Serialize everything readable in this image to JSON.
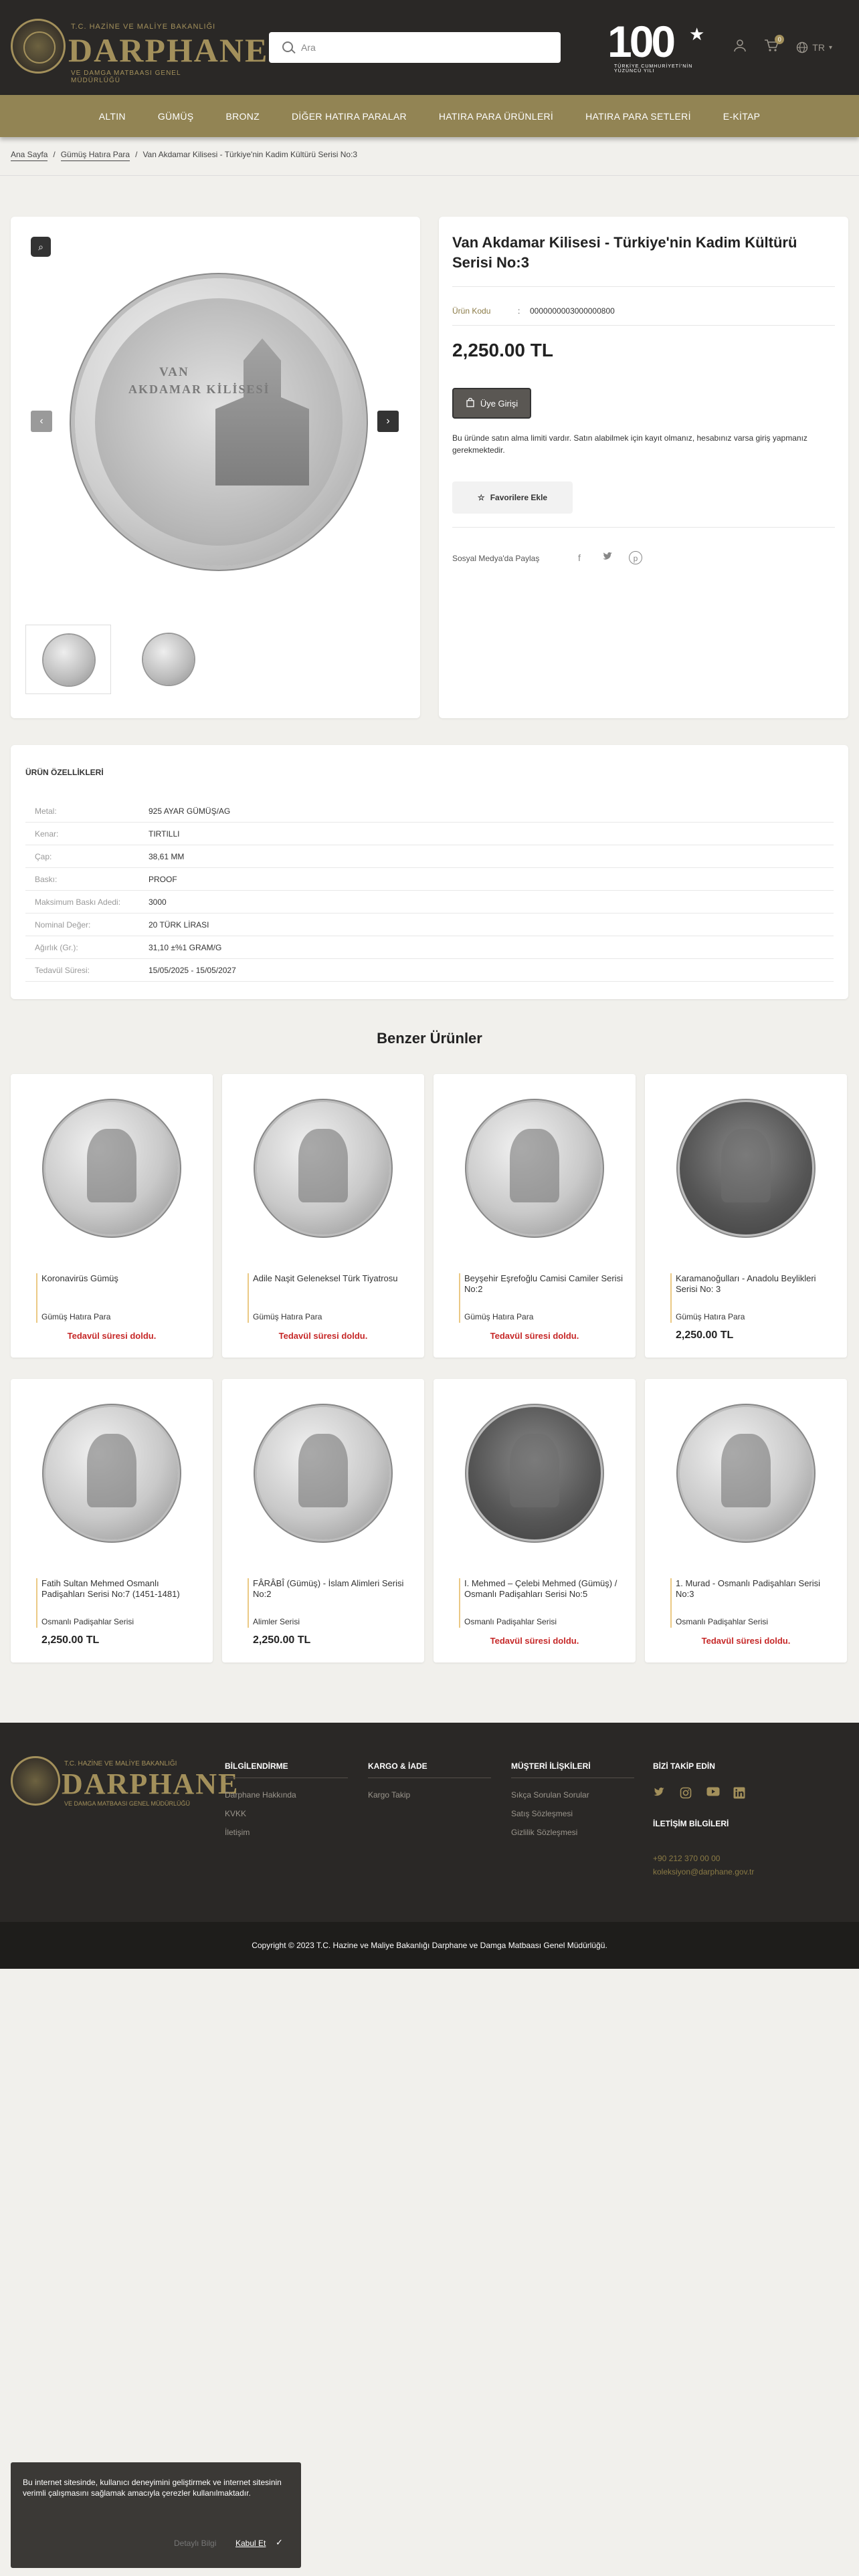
{
  "header": {
    "logo_sup": "T.C. HAZİNE VE MALİYE BAKANLIĞI",
    "logo_name": "DARPHANE",
    "logo_sub": "VE DAMGA MATBAASI GENEL MÜDÜRLÜĞÜ",
    "search_placeholder": "Ara",
    "centennial_num": "100",
    "centennial_caption": "TÜRKİYE CUMHURİYETİ'NİN YÜZÜNCÜ YILI",
    "cart_count": "0",
    "language": "TR"
  },
  "nav": [
    "ALTIN",
    "GÜMÜŞ",
    "BRONZ",
    "DİĞER HATIRA PARALAR",
    "HATIRA PARA ÜRÜNLERİ",
    "HATIRA PARA SETLERİ",
    "E-KİTAP"
  ],
  "breadcrumb": {
    "home": "Ana Sayfa",
    "category": "Gümüş Hatıra Para",
    "current": "Van Akdamar Kilisesi - Türkiye'nin Kadim Kültürü Serisi No:3",
    "sep": "/"
  },
  "gallery": {
    "coin_text_1": "VAN",
    "coin_text_2": "AKDAMAR KİLİSESİ"
  },
  "product": {
    "title": "Van Akdamar Kilisesi - Türkiye'nin Kadim Kültürü Serisi No:3",
    "code_label": "Ürün Kodu",
    "code_colon": ":",
    "code_value": "0000000003000000800",
    "price": "2,250.00 TL",
    "member_button": "Üye Girişi",
    "note": "Bu üründe satın alma limiti vardır. Satın alabilmek için kayıt olmanız, hesabınız varsa giriş yapmanız gerekmektedir.",
    "favorite_button": "Favorilere Ekle",
    "share_label": "Sosyal Medya'da Paylaş"
  },
  "features": {
    "title": "ÜRÜN ÖZELLİKLERİ",
    "rows": [
      {
        "k": "Metal:",
        "v": "925 AYAR GÜMÜŞ/AG"
      },
      {
        "k": "Kenar:",
        "v": "TIRTILLI"
      },
      {
        "k": "Çap:",
        "v": "38,61 MM"
      },
      {
        "k": "Baskı:",
        "v": "PROOF"
      },
      {
        "k": "Maksimum Baskı Adedi:",
        "v": "3000"
      },
      {
        "k": "Nominal Değer:",
        "v": "20 TÜRK LİRASI"
      },
      {
        "k": "Ağırlık (Gr.):",
        "v": "31,10 ±%1 GRAM/G"
      },
      {
        "k": "Tedavül Süresi:",
        "v": "15/05/2025 - 15/05/2027"
      }
    ]
  },
  "similar": {
    "title": "Benzer Ürünler",
    "items": [
      {
        "name": "Koronavirüs Gümüş",
        "category": "Gümüş Hatıra Para",
        "status": "Tedavül süresi doldu.",
        "price": ""
      },
      {
        "name": "Adile Naşit Geleneksel Türk Tiyatrosu",
        "category": "Gümüş Hatıra Para",
        "status": "Tedavül süresi doldu.",
        "price": ""
      },
      {
        "name": "Beyşehir Eşrefoğlu Camisi Camiler Serisi No:2",
        "category": "Gümüş Hatıra Para",
        "status": "Tedavül süresi doldu.",
        "price": ""
      },
      {
        "name": "Karamanoğulları - Anadolu Beylikleri Serisi No: 3",
        "category": "Gümüş Hatıra Para",
        "status": "",
        "price": "2,250.00 TL"
      },
      {
        "name": "Fatih Sultan Mehmed Osmanlı Padişahları Serisi No:7 (1451-1481)",
        "category": "Osmanlı Padişahlar Serisi",
        "status": "",
        "price": "2,250.00 TL"
      },
      {
        "name": "FÂRÂBÎ (Gümüş) - İslam Alimleri Serisi No:2",
        "category": "Alimler Serisi",
        "status": "",
        "price": "2,250.00 TL"
      },
      {
        "name": "I. Mehmed – Çelebi Mehmed (Gümüş) / Osmanlı Padişahları Serisi No:5",
        "category": "Osmanlı Padişahlar Serisi",
        "status": "Tedavül süresi doldu.",
        "price": ""
      },
      {
        "name": "1. Murad - Osmanlı Padişahları Serisi No:3",
        "category": "Osmanlı Padişahlar Serisi",
        "status": "Tedavül süresi doldu.",
        "price": ""
      }
    ]
  },
  "footer": {
    "logo_sup": "T.C. HAZİNE VE MALİYE BAKANLIĞI",
    "logo_name": "DARPHANE",
    "logo_sub": "VE DAMGA MATBAASI GENEL MÜDÜRLÜĞÜ",
    "col1": {
      "title": "BİLGİLENDİRME",
      "links": [
        "Darphane Hakkında",
        "KVKK",
        "İletişim"
      ]
    },
    "col2": {
      "title": "KARGO & İADE",
      "links": [
        "Kargo Takip"
      ]
    },
    "col3": {
      "title": "MÜŞTERİ İLİŞKİLERİ",
      "links": [
        "Sıkça Sorulan Sorular",
        "Satış Sözleşmesi",
        "Gizlilik Sözleşmesi"
      ]
    },
    "follow_title": "BİZİ TAKİP EDİN",
    "contact_title": "İLETİŞİM BİLGİLERİ",
    "phone": "+90 212 370 00 00",
    "email": "koleksiyon@darphane.gov.tr",
    "copyright": "Copyright © 2023 T.C. Hazine ve Maliye Bakanlığı Darphane ve Damga Matbaası Genel Müdürlüğü."
  },
  "cookie": {
    "text": "Bu internet sitesinde, kullanıcı deneyimini geliştirmek ve internet sitesinin verimli çalışmasını sağlamak amacıyla çerezler kullanılmaktadır.",
    "details": "Detaylı Bilgi",
    "accept": "Kabul Et"
  },
  "colors": {
    "header_bg": "#2a2826",
    "nav_bg": "#928454",
    "gold": "#a3905b",
    "expired_red": "#c62828"
  }
}
